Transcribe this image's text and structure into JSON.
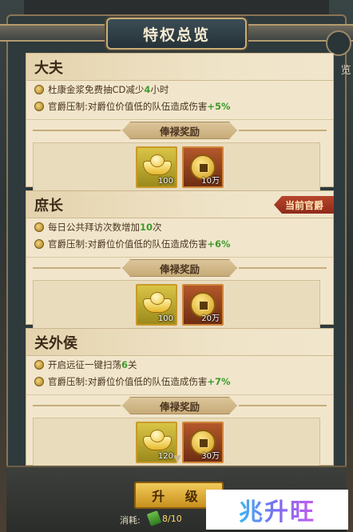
{
  "header": {
    "title": "特权总览",
    "side_tab": "览"
  },
  "reward_title": "俸禄奖励",
  "current_tag": "当前官爵",
  "sections": [
    {
      "name": "大夫",
      "perks": [
        {
          "prefix": "杜康金浆免费抽CD减少",
          "value": "4",
          "suffix": "小时"
        },
        {
          "prefix": "官爵压制:对爵位价值低的队伍造成伤害",
          "value": "+5%",
          "suffix": ""
        }
      ],
      "rewards": {
        "gold": "100",
        "coin": "10万"
      }
    },
    {
      "name": "庶长",
      "perks": [
        {
          "prefix": "每日公共拜访次数增加",
          "value": "10",
          "suffix": "次"
        },
        {
          "prefix": "官爵压制:对爵位价值低的队伍造成伤害",
          "value": "+6%",
          "suffix": ""
        }
      ],
      "rewards": {
        "gold": "100",
        "coin": "20万"
      }
    },
    {
      "name": "关外侯",
      "perks": [
        {
          "prefix": "开启远征一键扫荡",
          "value": "6",
          "suffix": "关"
        },
        {
          "prefix": "官爵压制:对爵位价值低的队伍造成伤害",
          "value": "+7%",
          "suffix": ""
        }
      ],
      "rewards": {
        "gold": "120",
        "coin": "30万"
      }
    }
  ],
  "footer": {
    "upgrade_label": "升 级",
    "cost_label": "消耗:",
    "cost_value": "8/10"
  },
  "watermark": "兆升旺"
}
